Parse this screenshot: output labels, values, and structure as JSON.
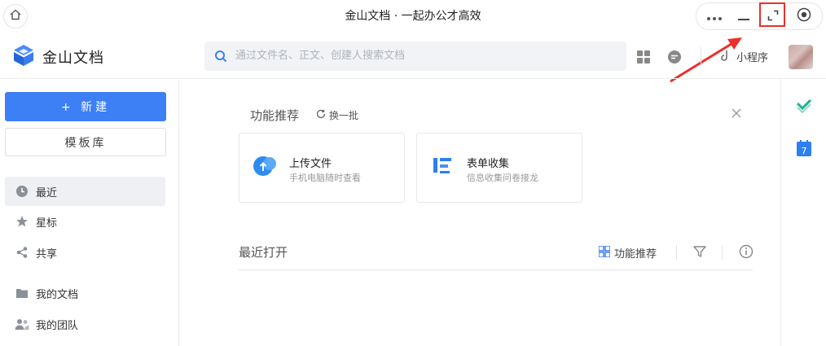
{
  "window": {
    "title": "金山文档 · 一起办公才高效"
  },
  "header": {
    "app_name": "金山文档",
    "search_placeholder": "通过文件名、正文、创建人搜索文档",
    "mini_program": "小程序"
  },
  "sidebar": {
    "new_button": "+ 新建",
    "template_button": "模板库",
    "items": [
      {
        "label": "最近",
        "icon": "clock-icon",
        "active": true
      },
      {
        "label": "星标",
        "icon": "star-icon"
      },
      {
        "label": "共享",
        "icon": "share-icon"
      },
      {
        "label": "我的文档",
        "icon": "folder-icon"
      },
      {
        "label": "我的团队",
        "icon": "team-icon"
      }
    ]
  },
  "recommend": {
    "title": "功能推荐",
    "refresh": "换一批",
    "cards": [
      {
        "title": "上传文件",
        "subtitle": "手机电脑随时查看",
        "icon": "cloud-upload-icon"
      },
      {
        "title": "表单收集",
        "subtitle": "信息收集问卷接龙",
        "icon": "form-icon"
      }
    ]
  },
  "recent": {
    "title": "最近打开",
    "feature_button": "功能推荐"
  },
  "colors": {
    "accent": "#3d7ff5",
    "highlight": "#e8312c",
    "rail_green": "#19b394",
    "rail_blue": "#2e7ff2"
  }
}
